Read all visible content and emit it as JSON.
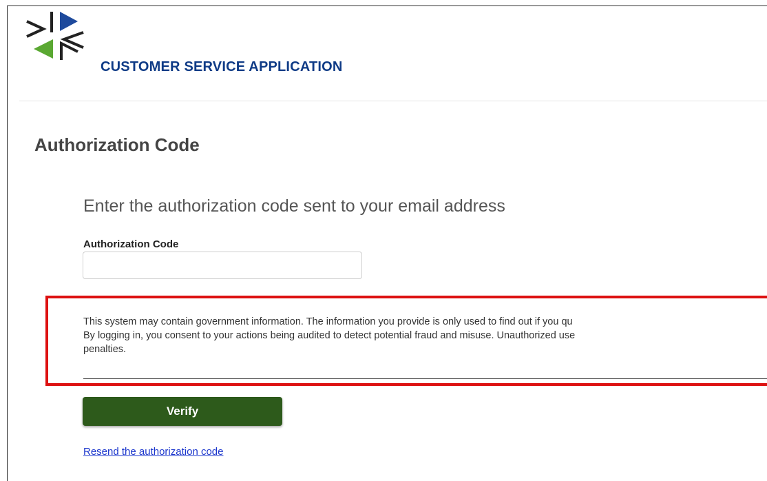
{
  "header": {
    "app_title": "CUSTOMER SERVICE APPLICATION",
    "logo_icon": "agency-star-logo-icon"
  },
  "main": {
    "page_title": "Authorization Code",
    "instructions": "Enter the authorization code sent to your email address",
    "field": {
      "label": "Authorization Code",
      "value": "",
      "placeholder": ""
    },
    "notice": {
      "lines": [
        "This system may contain government information. The information you provide is only used to find out if you qu",
        "By logging in, you consent to your actions being audited to detect potential fraud and misuse. Unauthorized use",
        "penalties."
      ]
    },
    "verify_label": "Verify",
    "resend_label": "Resend the authorization code"
  },
  "colors": {
    "brand_blue": "#0f3b86",
    "brand_green": "#5aa832",
    "button_green": "#2d5a1b",
    "notice_border": "#dd1111",
    "link": "#1a35cc"
  }
}
